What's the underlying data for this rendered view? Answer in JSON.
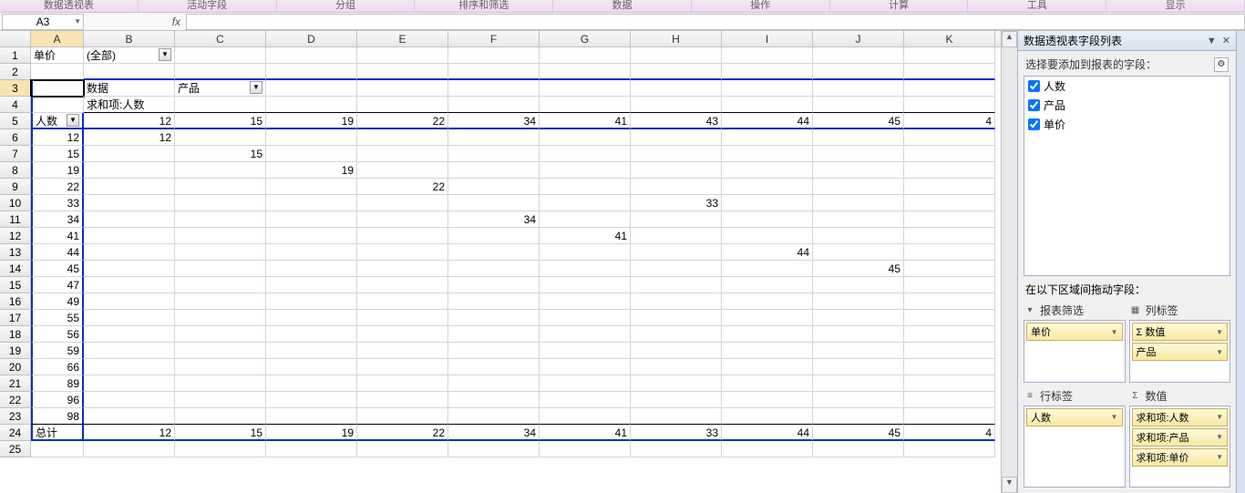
{
  "ribbon": {
    "tabs": [
      "数据透视表",
      "活动字段",
      "分组",
      "排序和筛选",
      "数据",
      "操作",
      "计算",
      "工具",
      "显示"
    ]
  },
  "formula_bar": {
    "name_box": "A3",
    "fx_label": "fx",
    "formula": ""
  },
  "columns": [
    "A",
    "B",
    "C",
    "D",
    "E",
    "F",
    "G",
    "H",
    "I",
    "J",
    "K"
  ],
  "sheet": {
    "r1": {
      "A": "单价",
      "B": "(全部)"
    },
    "r3": {
      "B": "数据",
      "C": "产品"
    },
    "r4": {
      "B": "求和项:人数"
    },
    "r5": {
      "A": "人数",
      "B": "12",
      "C": "15",
      "D": "19",
      "E": "22",
      "F": "34",
      "G": "41",
      "H": "43",
      "I": "44",
      "J": "45",
      "K": "4"
    },
    "r6": {
      "A": "12",
      "B": "12"
    },
    "r7": {
      "A": "15",
      "C": "15"
    },
    "r8": {
      "A": "19",
      "D": "19"
    },
    "r9": {
      "A": "22",
      "E": "22"
    },
    "r10": {
      "A": "33",
      "H": "33"
    },
    "r11": {
      "A": "34",
      "F": "34"
    },
    "r12": {
      "A": "41",
      "G": "41"
    },
    "r13": {
      "A": "44",
      "I": "44"
    },
    "r14": {
      "A": "45",
      "J": "45"
    },
    "r15": {
      "A": "47"
    },
    "r16": {
      "A": "49"
    },
    "r17": {
      "A": "55"
    },
    "r18": {
      "A": "56"
    },
    "r19": {
      "A": "59"
    },
    "r20": {
      "A": "66"
    },
    "r21": {
      "A": "89"
    },
    "r22": {
      "A": "96"
    },
    "r23": {
      "A": "98"
    },
    "r24": {
      "A": "总计",
      "B": "12",
      "C": "15",
      "D": "19",
      "E": "22",
      "F": "34",
      "G": "41",
      "H": "33",
      "I": "44",
      "J": "45",
      "K": "4"
    }
  },
  "pivot_panel": {
    "title": "数据透视表字段列表",
    "choose_label": "选择要添加到报表的字段：",
    "fields": [
      {
        "name": "人数",
        "checked": true
      },
      {
        "name": "产品",
        "checked": true
      },
      {
        "name": "单价",
        "checked": true
      }
    ],
    "areas_label": "在以下区域间拖动字段：",
    "areas": {
      "filter": {
        "label": "报表筛选",
        "chips": [
          "单价"
        ]
      },
      "columns": {
        "label": "列标签",
        "chips": [
          "Σ 数值",
          "产品"
        ]
      },
      "rows": {
        "label": "行标签",
        "chips": [
          "人数"
        ]
      },
      "values": {
        "label": "数值",
        "chips": [
          "求和项:人数",
          "求和项:产品",
          "求和项:单价"
        ]
      }
    }
  }
}
